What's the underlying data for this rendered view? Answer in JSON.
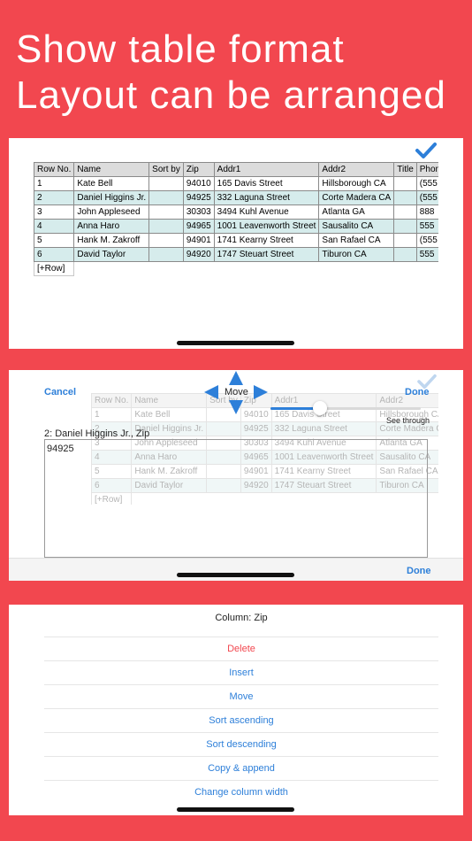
{
  "headline": {
    "line1": "Show table format",
    "line2": "Layout can be arranged"
  },
  "table": {
    "headers": [
      "Row No.",
      "Name",
      "Sort by",
      "Zip",
      "Addr1",
      "Addr2",
      "Title",
      "Phone"
    ],
    "rows": [
      [
        "1",
        "Kate Bell",
        "",
        "94010",
        "165 Davis Street",
        "Hillsborough CA",
        "",
        "(555"
      ],
      [
        "2",
        "Daniel Higgins Jr.",
        "",
        "94925",
        "332 Laguna Street",
        "Corte Madera CA",
        "",
        "(555"
      ],
      [
        "3",
        "John Appleseed",
        "",
        "30303",
        "3494 Kuhl Avenue",
        "Atlanta GA",
        "",
        "888"
      ],
      [
        "4",
        "Anna Haro",
        "",
        "94965",
        "1001  Leavenworth Street",
        "Sausalito CA",
        "",
        "555"
      ],
      [
        "5",
        "Hank M. Zakroff",
        "",
        "94901",
        "1741 Kearny Street",
        "San Rafael CA",
        "",
        "(555"
      ],
      [
        "6",
        "David Taylor",
        "",
        "94920",
        "1747 Steuart Street",
        "Tiburon CA",
        "",
        "555"
      ]
    ],
    "add_row": "[+Row]"
  },
  "editor": {
    "cancel": "Cancel",
    "done_top": "Done",
    "move": "Move",
    "see_through": "See through",
    "cell_label": "2: Daniel Higgins Jr., Zip",
    "cell_value": "94925",
    "done_bottom": "Done"
  },
  "menu": {
    "title": "Column: Zip",
    "items": [
      "Delete",
      "Insert",
      "Move",
      "Sort ascending",
      "Sort descending",
      "Copy & append",
      "Change column width"
    ]
  },
  "colors": {
    "background": "#f2474f",
    "accent": "#2d7fd9",
    "delete": "#f2474f",
    "row_alt": "#d6ecec"
  },
  "icons": [
    "checkmark-icon",
    "arrow-up-icon",
    "arrow-down-icon",
    "arrow-left-icon",
    "arrow-right-icon"
  ]
}
